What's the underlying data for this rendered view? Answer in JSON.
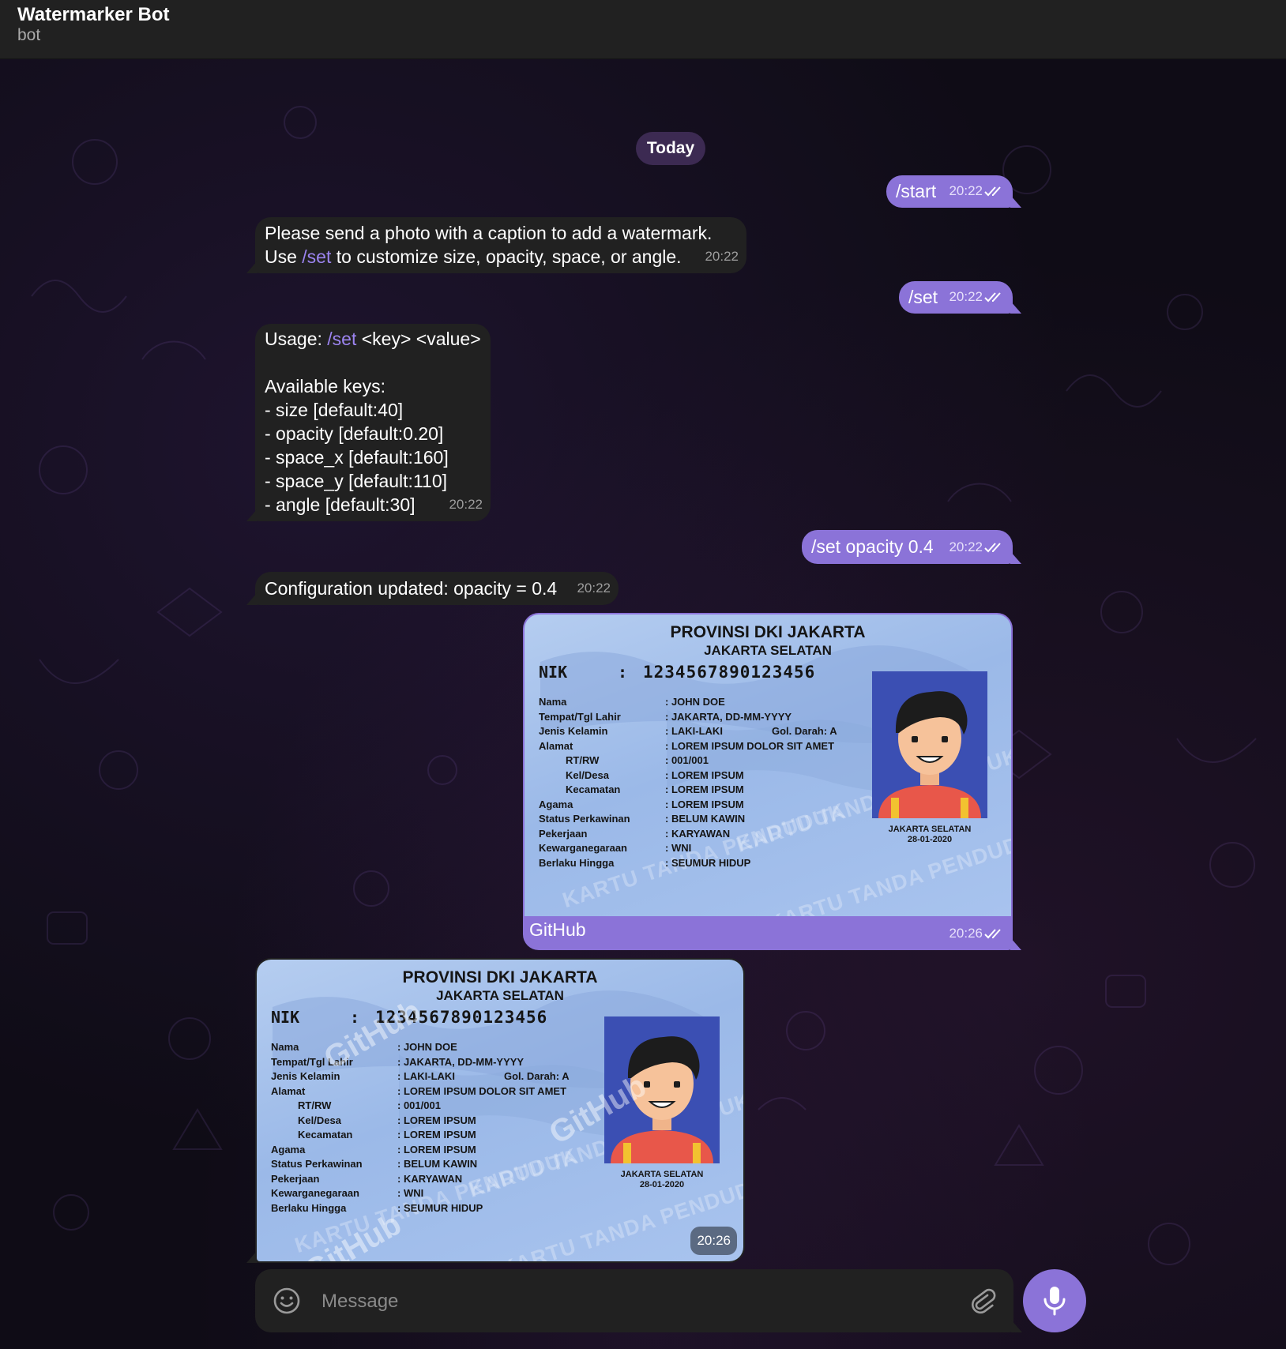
{
  "header": {
    "title": "Watermarker Bot",
    "subtitle": "bot"
  },
  "date_divider": "Today",
  "messages": {
    "m1": {
      "text": "/start",
      "time": "20:22"
    },
    "m2": {
      "line1": "Please send a photo with a caption to add a watermark.",
      "line2_pre": "Use ",
      "line2_cmd": "/set",
      "line2_post": " to customize size, opacity, space, or angle.",
      "time": "20:22"
    },
    "m3": {
      "text": "/set",
      "time": "20:22"
    },
    "m4": {
      "usage_pre": "Usage: ",
      "usage_cmd": "/set",
      "usage_post": " <key> <value>",
      "keys_title": "Available keys:",
      "keys": [
        "- size [default:40]",
        "- opacity [default:0.20]",
        "- space_x [default:160]",
        "- space_y [default:110]",
        "- angle [default:30]"
      ],
      "time": "20:22"
    },
    "m5": {
      "text": "/set opacity 0.4",
      "time": "20:22"
    },
    "m6": {
      "text": "Configuration updated: opacity = 0.4",
      "time": "20:22"
    },
    "m7": {
      "caption": "GitHub",
      "time": "20:26"
    },
    "m8": {
      "time": "20:26"
    }
  },
  "id_card": {
    "province": "PROVINSI DKI JAKARTA",
    "city": "JAKARTA SELATAN",
    "nik_label": "NIK",
    "nik_colon": ":",
    "nik": "1234567890123456",
    "rows": [
      {
        "k": "Nama",
        "v": ": JOHN DOE"
      },
      {
        "k": "Tempat/Tgl Lahir",
        "v": ": JAKARTA, DD-MM-YYYY"
      },
      {
        "k": "Jenis Kelamin",
        "v": ": LAKI-LAKI",
        "g": "Gol. Darah: A"
      },
      {
        "k": "Alamat",
        "v": ": LOREM IPSUM DOLOR SIT AMET"
      },
      {
        "k": "RT/RW",
        "v": ": 001/001",
        "indent": true
      },
      {
        "k": "Kel/Desa",
        "v": ": LOREM IPSUM",
        "indent": true
      },
      {
        "k": "Kecamatan",
        "v": ": LOREM IPSUM",
        "indent": true
      },
      {
        "k": "Agama",
        "v": ": LOREM IPSUM"
      },
      {
        "k": "Status Perkawinan",
        "v": ": BELUM KAWIN"
      },
      {
        "k": "Pekerjaan",
        "v": ": KARYAWAN"
      },
      {
        "k": "Kewarganegaraan",
        "v": ": WNI"
      },
      {
        "k": "Berlaku Hingga",
        "v": ": SEUMUR HIDUP"
      }
    ],
    "issue_place": "JAKARTA SELATAN",
    "issue_date": "28-01-2020",
    "background_text": "KARTU TANDA PENDUDUK"
  },
  "watermark_text": "GitHub",
  "composer": {
    "placeholder": "Message"
  },
  "icons": {
    "emoji": "emoji-icon",
    "attach": "paperclip-icon",
    "mic": "microphone-icon",
    "read": "double-check-icon"
  },
  "colors": {
    "outgoing": "#8b73d8",
    "incoming": "#212121",
    "command_link": "#9c84f0",
    "header": "#212121"
  }
}
